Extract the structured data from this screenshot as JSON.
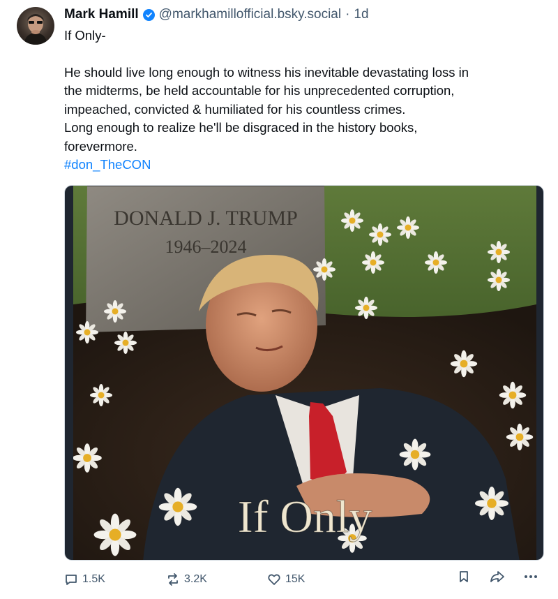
{
  "post": {
    "author_name": "Mark Hamill",
    "author_handle": "@markhamillofficial.bsky.social",
    "separator": "·",
    "time": "1d",
    "text_line_1": "If Only-",
    "paragraph": [
      "He should live long enough to witness his inevitable devastating loss in",
      "the midterms, be held accountable for his unprecedented corruption,",
      "impeached, convicted & humiliated for his countless crimes.",
      "Long enough to realize he'll be disgraced in the history books,",
      "forevermore."
    ],
    "hashtag": "#don_TheCON"
  },
  "image": {
    "headstone_name": "DONALD J. TRUMP",
    "headstone_years": "1946–2024",
    "caption": "If Only"
  },
  "actions": {
    "replies": "1.5K",
    "reposts": "3.2K",
    "likes": "15K"
  },
  "colors": {
    "link": "#1083fe",
    "muted": "#42576c",
    "text": "#0b0f14",
    "verified": "#1083fe"
  },
  "icons": [
    "verified-badge-icon",
    "reply-icon",
    "repost-icon",
    "like-icon",
    "bookmark-icon",
    "share-icon",
    "more-icon"
  ]
}
